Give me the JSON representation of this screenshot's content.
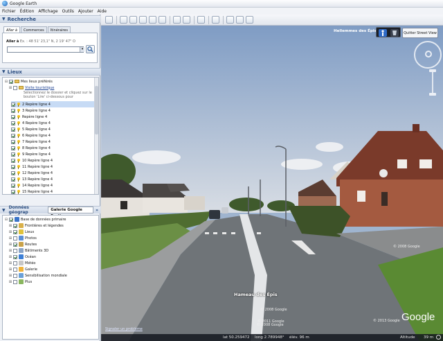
{
  "app": {
    "title": "Google Earth"
  },
  "menu": [
    "Fichier",
    "Édition",
    "Affichage",
    "Outils",
    "Ajouter",
    "Aide"
  ],
  "search": {
    "header": "Recherche",
    "tabs": [
      "Aller à",
      "Commerces",
      "Itinéraires"
    ],
    "goto_label": "Aller à",
    "goto_example": "Ex. : 48 51' 23,1\" N, 2 19' 47\" O",
    "value": ""
  },
  "places": {
    "header": "Lieux",
    "my_places": "Mes lieux préférés",
    "tour": "Visite touristique",
    "tour_hint": "Sélectionnez le dossier et cliquez sur le bouton 'Lire' ci-dessous pour",
    "items": [
      "2 Repère ligne 4",
      "3 Repère ligne 4",
      "Repère ligne 4",
      "4 Repère ligne 4",
      "5 Repère ligne 4",
      "6 Repère ligne 4",
      "7 Repère ligne 4",
      "8 Repère ligne 4",
      "9 Repère ligne 4",
      "10 Repère ligne 4",
      "11 Repère ligne 4",
      "12 Repère ligne 4",
      "13 Repère ligne 4",
      "14 Repère ligne 4",
      "15 Repère ligne 4"
    ]
  },
  "layers": {
    "tab_data": "Données géograp",
    "tab_gallery": "Galerie Google Earth",
    "gallery_arrow": "»",
    "root": "Base de données primaire",
    "items": [
      "Frontières et légendes",
      "Lieux",
      "Photos",
      "Routes",
      "Bâtiments 3D",
      "Océan",
      "Météo",
      "Galerie",
      "Sensibilisation mondiale",
      "Plus"
    ]
  },
  "view": {
    "place_label": "Hellemmes des Épis",
    "quit_button": "Quitter Street View",
    "street_name": "Hameau des Épis",
    "copyright_1": "© 2008 Google",
    "copyright_2": "© 2008 Google",
    "copyright_3": "© 2011 Google",
    "copyright_4": "© 2008 Google",
    "logo_copyright": "© 2013 Google",
    "google_logo": "Google",
    "report_link": "Signaler un problème"
  },
  "status": {
    "lat": "lat  50.259472",
    "lon": "long  2.789948°",
    "elev": "élév.  96 m",
    "alt_label": "Altitude",
    "alt_value": "39 m"
  },
  "colors": {
    "sky": "#9fb4cf",
    "road": "#6f7478",
    "grass": "#5f8a3a",
    "brick": "#8c4a35",
    "header_text": "#2a4d80"
  }
}
